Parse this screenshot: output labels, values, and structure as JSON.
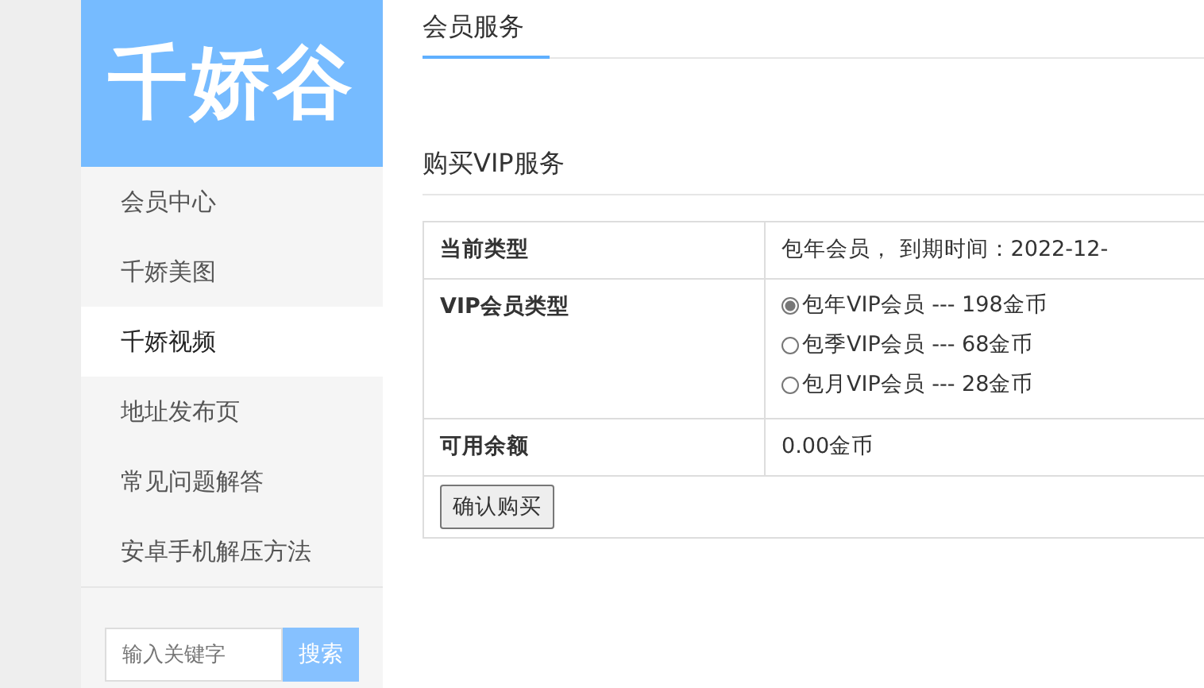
{
  "logo": {
    "text": "千娇谷"
  },
  "nav": [
    {
      "label": "会员中心",
      "selected": false
    },
    {
      "label": "千娇美图",
      "selected": false
    },
    {
      "label": "千娇视频",
      "selected": true
    },
    {
      "label": "地址发布页",
      "selected": false
    },
    {
      "label": "常见问题解答",
      "selected": false
    },
    {
      "label": "安卓手机解压方法",
      "selected": false
    }
  ],
  "search": {
    "placeholder": "输入关键字",
    "button": "搜索"
  },
  "page_title": "会员服务",
  "section_title": "购买VIP服务",
  "rows": [
    {
      "label": "当前类型",
      "kind": "text",
      "value": "包年会员， 到期时间：2022-12-"
    },
    {
      "label": "VIP会员类型",
      "kind": "options",
      "options": [
        {
          "label": "包年VIP会员 --- 198金币",
          "selected": true
        },
        {
          "label": "包季VIP会员 --- 68金币",
          "selected": false
        },
        {
          "label": "包月VIP会员 --- 28金币",
          "selected": false
        }
      ]
    },
    {
      "label": "可用余额",
      "kind": "text",
      "value": "0.00金币"
    }
  ],
  "submit": "确认购买"
}
